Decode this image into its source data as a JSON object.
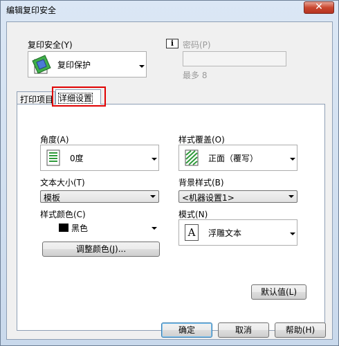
{
  "window": {
    "title": "编辑复印安全",
    "close_glyph": "✕"
  },
  "copy_security": {
    "label": "复印安全(Y)",
    "value": "复印保护"
  },
  "password": {
    "info_glyph": "i",
    "label": "密码(P)",
    "value": "",
    "hint": "最多 8"
  },
  "tabs": [
    {
      "label": "打印项目"
    },
    {
      "label": "详细设置"
    }
  ],
  "angle": {
    "label": "角度(A)",
    "value": "0度"
  },
  "text_size": {
    "label": "文本大小(T)",
    "value": "模板"
  },
  "pattern_color": {
    "label": "样式颜色(C)",
    "value": "黑色"
  },
  "adjust_color": {
    "label": "调整颜色(J)..."
  },
  "pattern_overwrite": {
    "label": "样式覆盖(O)",
    "value": "正面（覆写）"
  },
  "background_pattern": {
    "label": "背景样式(B)",
    "value": "<机器设置1>"
  },
  "mode": {
    "label": "模式(N)",
    "value": "浮雕文本",
    "icon_glyph": "A"
  },
  "default_button": {
    "label": "默认值(L)"
  },
  "buttons": {
    "ok": "确定",
    "cancel": "取消",
    "help": "帮助(H)"
  },
  "colors": {
    "highlight_border": "#e00000",
    "ok_border": "#3c7fb1",
    "swatch": "#000000"
  }
}
